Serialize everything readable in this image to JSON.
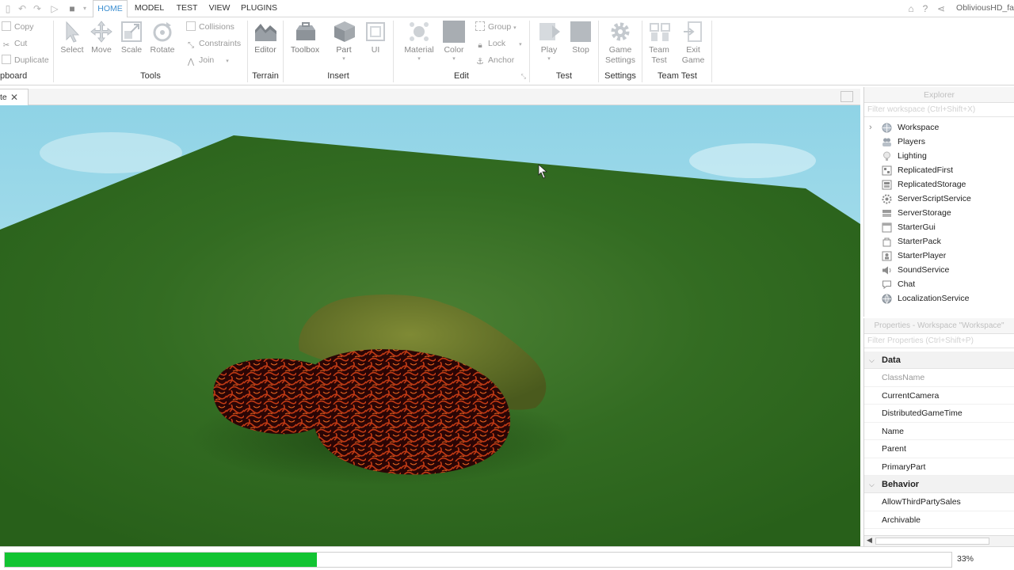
{
  "user": {
    "name": "ObliviousHD_fa"
  },
  "menu": {
    "tabs": [
      "HOME",
      "MODEL",
      "TEST",
      "VIEW",
      "PLUGINS"
    ],
    "active": "HOME"
  },
  "ribbon": {
    "clipboard": {
      "label": "pboard",
      "copy": "Copy",
      "cut": "Cut",
      "duplicate": "Duplicate"
    },
    "tools": {
      "label": "Tools",
      "select": "Select",
      "move": "Move",
      "scale": "Scale",
      "rotate": "Rotate",
      "collisions": "Collisions",
      "constraints": "Constraints",
      "join": "Join"
    },
    "terrain": {
      "label": "Terrain",
      "editor": "Editor"
    },
    "insert": {
      "label": "Insert",
      "toolbox": "Toolbox",
      "part": "Part",
      "ui": "UI"
    },
    "edit": {
      "label": "Edit",
      "material": "Material",
      "color": "Color",
      "group": "Group",
      "lock": "Lock",
      "anchor": "Anchor"
    },
    "test": {
      "label": "Test",
      "play": "Play",
      "stop": "Stop"
    },
    "settings": {
      "label": "Settings",
      "game_settings_1": "Game",
      "game_settings_2": "Settings"
    },
    "team_test": {
      "label": "Team Test",
      "team_test_1": "Team",
      "team_test_2": "Test",
      "exit_game_1": "Exit",
      "exit_game_2": "Game"
    }
  },
  "doc_tab": {
    "title": "te"
  },
  "explorer": {
    "title": "Explorer",
    "filter_placeholder": "Filter workspace (Ctrl+Shift+X)",
    "items": [
      "Workspace",
      "Players",
      "Lighting",
      "ReplicatedFirst",
      "ReplicatedStorage",
      "ServerScriptService",
      "ServerStorage",
      "StarterGui",
      "StarterPack",
      "StarterPlayer",
      "SoundService",
      "Chat",
      "LocalizationService"
    ]
  },
  "properties": {
    "title": "Properties - Workspace \"Workspace\"",
    "filter_placeholder": "Filter Properties (Ctrl+Shift+P)",
    "data_category": "Data",
    "data_rows": [
      "ClassName",
      "CurrentCamera",
      "DistributedGameTime",
      "Name",
      "Parent",
      "PrimaryPart"
    ],
    "behavior_category": "Behavior",
    "behavior_rows": [
      "AllowThirdPartySales",
      "Archivable"
    ]
  },
  "progress": {
    "value": 0.33,
    "label": "33%"
  },
  "colors": {
    "accent": "#3d8fd1",
    "progress": "#12c432",
    "grass": "#2f6b1e",
    "sky": "#9fdbea"
  }
}
